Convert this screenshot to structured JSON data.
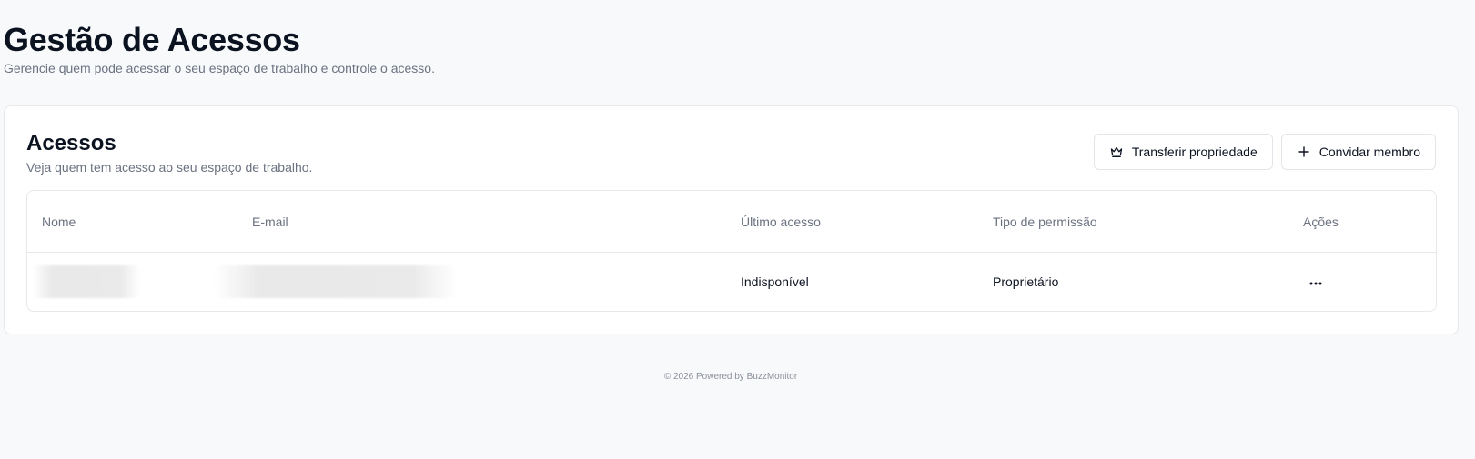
{
  "header": {
    "title": "Gestão de Acessos",
    "subtitle": "Gerencie quem pode acessar o seu espaço de trabalho e controle o acesso."
  },
  "card": {
    "title": "Acessos",
    "subtitle": "Veja quem tem acesso ao seu espaço de trabalho.",
    "buttons": {
      "transfer": {
        "label": "Transferir propriedade",
        "icon": "crown-icon"
      },
      "invite": {
        "label": "Convidar membro",
        "icon": "plus-icon"
      }
    }
  },
  "table": {
    "columns": {
      "name": "Nome",
      "email": "E-mail",
      "last_access": "Último acesso",
      "permission": "Tipo de permissão",
      "actions": "Ações"
    },
    "rows": [
      {
        "last_access": "Indisponível",
        "permission": "Proprietário",
        "actions_icon": "more-horizontal-icon"
      }
    ]
  },
  "footer": {
    "text": "© 2026 Powered by BuzzMonitor"
  }
}
